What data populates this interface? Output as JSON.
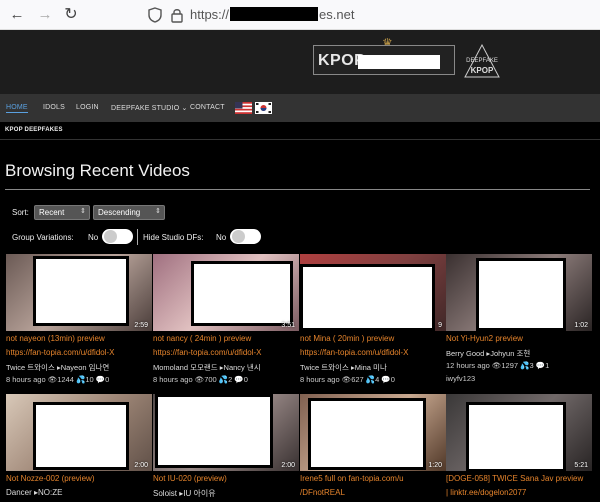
{
  "browser": {
    "url_prefix": "https://",
    "url_suffix": "es.net"
  },
  "banner": {
    "logo_text": "KPOP",
    "badge_line1": "DEEPFAKE",
    "badge_line2": "KPOP"
  },
  "nav": {
    "items": [
      "HOME",
      "IDOLS",
      "LOGIN",
      "DEEPFAKE STUDIO",
      "CONTACT"
    ],
    "studio_caret": "⌄"
  },
  "site_label": "KPOP DEEPFAKES",
  "page_title": "Browsing Recent Videos",
  "controls": {
    "sort_label": "Sort:",
    "sort_value": "Recent",
    "order_value": "Descending",
    "group_label": "Group Variations:",
    "group_value": "No",
    "studio_label": "Hide Studio DFs:",
    "studio_value": "No"
  },
  "videos": [
    {
      "title": "not nayeon (13min) preview",
      "link": "https://fan-topia.com/u/dfidol-X",
      "cast": "Twice 트와이스 ▸Nayeon 임나연",
      "stats": "8 hours ago 👁1244 💦10 💬0",
      "duration": "2:59",
      "extra": ""
    },
    {
      "title": "not nancy ( 24min ) preview",
      "link": "https://fan-topia.com/u/dfidol-X",
      "cast": "Momoland 모모랜드 ▸Nancy 낸시",
      "stats": "8 hours ago 👁700 💦2 💬0",
      "duration": "3:51",
      "extra": ""
    },
    {
      "title": "not Mina ( 20min ) preview",
      "link": "https://fan-topia.com/u/dfidol-X",
      "cast": "Twice 트와이스 ▸Mina 미나",
      "stats": "8 hours ago 👁627 💦4 💬0",
      "duration": "9",
      "extra": ""
    },
    {
      "title": "Not Yi-Hyun2 preview",
      "link": "",
      "cast": "Berry Good ▸Johyun 조현",
      "stats": "12 hours ago 👁1297 💦3 💬1",
      "duration": "1:02",
      "extra": "iwyfv123"
    },
    {
      "title": "Not Nozze-002 (preview)",
      "link": "",
      "cast": "Dancer ▸NO:ZE",
      "stats": "",
      "duration": "2:00",
      "extra": ""
    },
    {
      "title": "Not IU-020 (preview)",
      "link": "",
      "cast": "Soloist ▸IU 아이유",
      "stats": "",
      "duration": "2:00",
      "extra": ""
    },
    {
      "title": "Irene5 full on fan-topia.com/u",
      "link": "/DFnotREAL",
      "cast": "",
      "stats": "",
      "duration": "1:20",
      "extra": ""
    },
    {
      "title": "[DOGE-058] TWICE Sana Jav preview",
      "link": "| linktr.ee/dogelon2077",
      "cast": "",
      "stats": "",
      "duration": "5:21",
      "extra": ""
    }
  ],
  "colors": {
    "accent_orange": "#e6842c",
    "nav_active": "#5aa0e0"
  }
}
